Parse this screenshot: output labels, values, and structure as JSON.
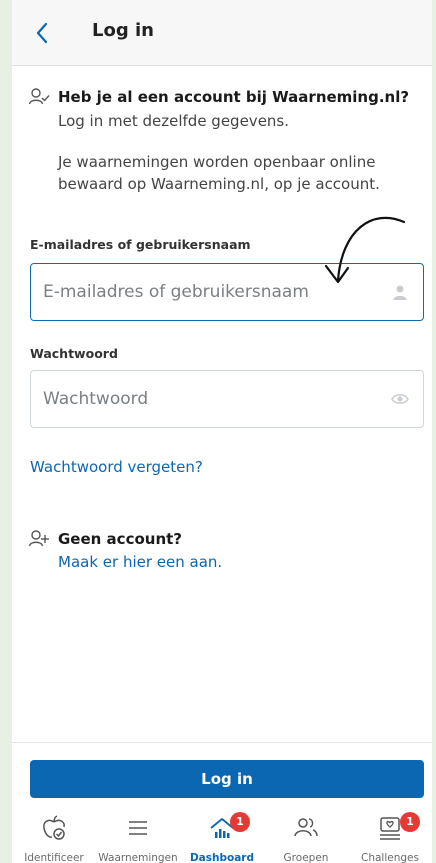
{
  "header": {
    "cut_title": "Log in",
    "title": "Log in"
  },
  "account_section": {
    "heading": "Heb je al een account bij Waarneming.nl?",
    "subtext": "Log in met dezelfde gegevens.",
    "info": "Je waarnemingen worden openbaar online bewaard op Waarneming.nl, op je account."
  },
  "email_field": {
    "label": "E-mailadres of gebruikersnaam",
    "placeholder": "E-mailadres of gebruikersnaam",
    "value": ""
  },
  "password_field": {
    "label": "Wachtwoord",
    "placeholder": "Wachtwoord",
    "value": ""
  },
  "forgot_password_link": "Wachtwoord vergeten?",
  "register_section": {
    "heading": "Geen account?",
    "link": "Maak er hier een aan."
  },
  "login_button": "Log in",
  "bottom_nav": [
    {
      "label": "Identificeer",
      "icon": "apple-check-icon",
      "badge": null,
      "active": false
    },
    {
      "label": "Waarnemingen",
      "icon": "list-icon",
      "badge": null,
      "active": false
    },
    {
      "label": "Dashboard",
      "icon": "dashboard-icon",
      "badge": "1",
      "active": true
    },
    {
      "label": "Groepen",
      "icon": "group-icon",
      "badge": null,
      "active": false
    },
    {
      "label": "Challenges",
      "icon": "challenge-icon",
      "badge": "1",
      "active": false
    }
  ],
  "colors": {
    "accent": "#0b67b1",
    "link": "#0d66ae",
    "badge": "#e53935",
    "page_bg": "#e8f0e4"
  }
}
